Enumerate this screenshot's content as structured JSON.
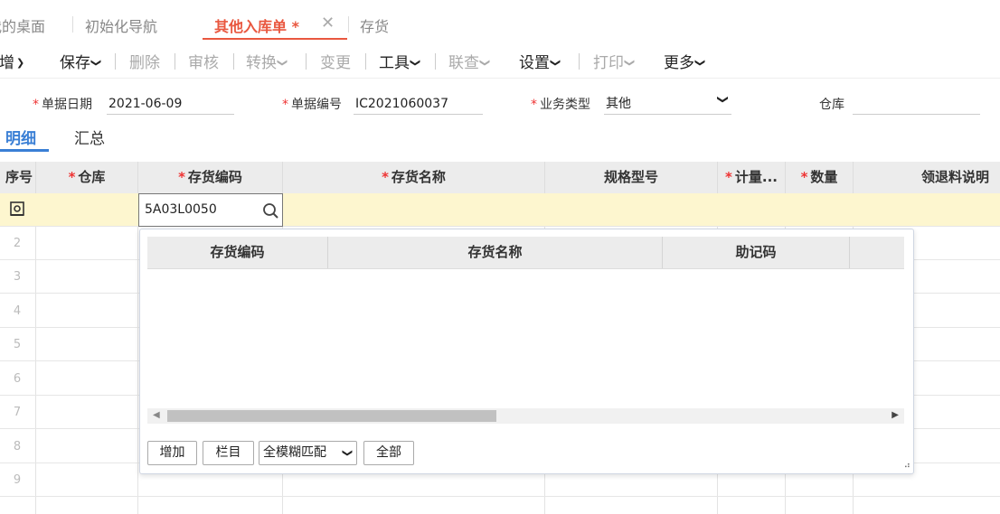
{
  "tabs": [
    {
      "label": "我的桌面"
    },
    {
      "label": "初始化导航"
    },
    {
      "label": "其他入库单 *"
    },
    {
      "label": "存货"
    }
  ],
  "toolbar": {
    "new": "新增",
    "save": "保存",
    "delete": "删除",
    "audit": "审核",
    "convert": "转换",
    "change": "变更",
    "tools": "工具",
    "lookup": "联查",
    "settings": "设置",
    "print": "打印",
    "more": "更多"
  },
  "form": {
    "date_label": "单据日期",
    "date_value": "2021-06-09",
    "number_label": "单据编号",
    "number_value": "IC2021060037",
    "biztype_label": "业务类型",
    "biztype_value": "其他",
    "warehouse_label": "仓库",
    "warehouse_value": ""
  },
  "subtabs": {
    "detail": "明细",
    "summary": "汇总"
  },
  "grid": {
    "columns": [
      "序号",
      "仓库",
      "存货编码",
      "存货名称",
      "规格型号",
      "计量...",
      "数量",
      "领退料说明"
    ],
    "required": [
      false,
      true,
      true,
      true,
      false,
      true,
      true,
      false
    ],
    "row_numbers": [
      "2",
      "3",
      "4",
      "5",
      "6",
      "7",
      "8",
      "9"
    ],
    "edit_value": "5A03L0050"
  },
  "dropdown": {
    "columns": [
      "存货编码",
      "存货名称",
      "助记码"
    ],
    "buttons": {
      "add": "增加",
      "columns": "栏目"
    },
    "match_mode": "全模糊匹配",
    "all": "全部"
  },
  "colors": {
    "accent": "#e9573f",
    "active_row": "#fdf6cf",
    "link": "#3a7fd5"
  }
}
